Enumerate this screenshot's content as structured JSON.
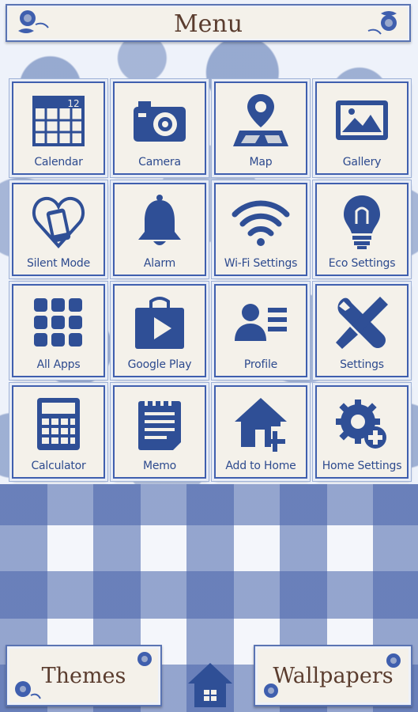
{
  "header": {
    "title": "Menu"
  },
  "tiles": [
    {
      "label": "Calendar",
      "icon": "calendar-icon",
      "badge": "12"
    },
    {
      "label": "Camera",
      "icon": "camera-icon"
    },
    {
      "label": "Map",
      "icon": "map-icon"
    },
    {
      "label": "Gallery",
      "icon": "gallery-icon"
    },
    {
      "label": "Silent Mode",
      "icon": "silent-mode-icon"
    },
    {
      "label": "Alarm",
      "icon": "bell-icon"
    },
    {
      "label": "Wi-Fi Settings",
      "icon": "wifi-icon"
    },
    {
      "label": "Eco Settings",
      "icon": "lightbulb-icon"
    },
    {
      "label": "All Apps",
      "icon": "apps-grid-icon"
    },
    {
      "label": "Google Play",
      "icon": "play-store-icon"
    },
    {
      "label": "Profile",
      "icon": "profile-icon"
    },
    {
      "label": "Settings",
      "icon": "tools-icon"
    },
    {
      "label": "Calculator",
      "icon": "calculator-icon"
    },
    {
      "label": "Memo",
      "icon": "memo-icon"
    },
    {
      "label": "Add to Home",
      "icon": "add-home-icon"
    },
    {
      "label": "Home Settings",
      "icon": "home-settings-icon"
    }
  ],
  "bottom": {
    "themes_label": "Themes",
    "wallpapers_label": "Wallpapers"
  },
  "colors": {
    "icon_blue": "#2f4f96",
    "label_blue": "#2d4a8e",
    "title_brown": "#5a3c2e"
  }
}
